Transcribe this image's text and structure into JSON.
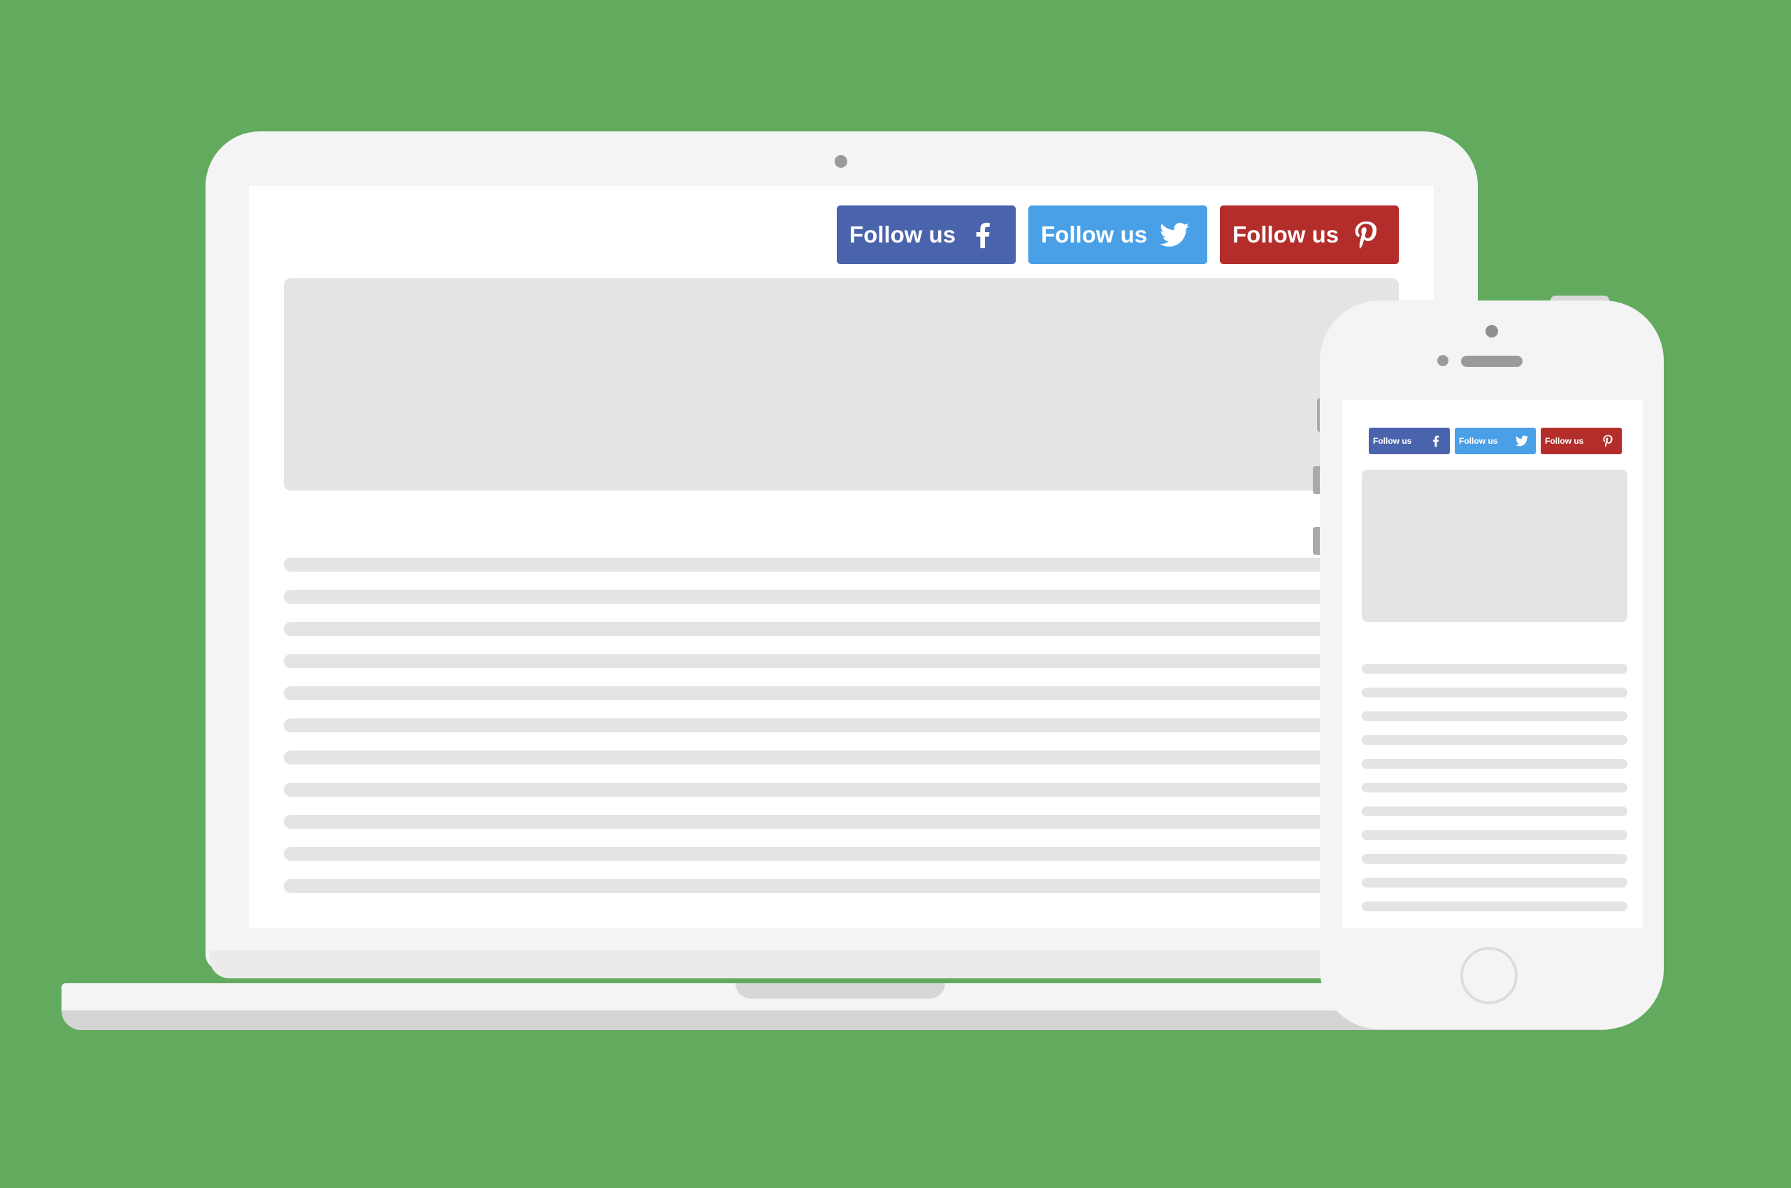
{
  "background_color": "#61aa5e",
  "laptop": {
    "follow_buttons": [
      {
        "label": "Follow us",
        "network": "facebook",
        "icon": "facebook-icon",
        "color": "#4a63ad"
      },
      {
        "label": "Follow us",
        "network": "twitter",
        "icon": "twitter-icon",
        "color": "#4aa0e6"
      },
      {
        "label": "Follow us",
        "network": "pinterest",
        "icon": "pinterest-icon",
        "color": "#b32e2b"
      }
    ],
    "content_line_count": 11
  },
  "phone": {
    "follow_buttons": [
      {
        "label": "Follow us",
        "network": "facebook",
        "icon": "facebook-icon",
        "color": "#4a63ad"
      },
      {
        "label": "Follow us",
        "network": "twitter",
        "icon": "twitter-icon",
        "color": "#4aa0e6"
      },
      {
        "label": "Follow us",
        "network": "pinterest",
        "icon": "pinterest-icon",
        "color": "#b32e2b"
      }
    ],
    "content_line_count": 11
  }
}
